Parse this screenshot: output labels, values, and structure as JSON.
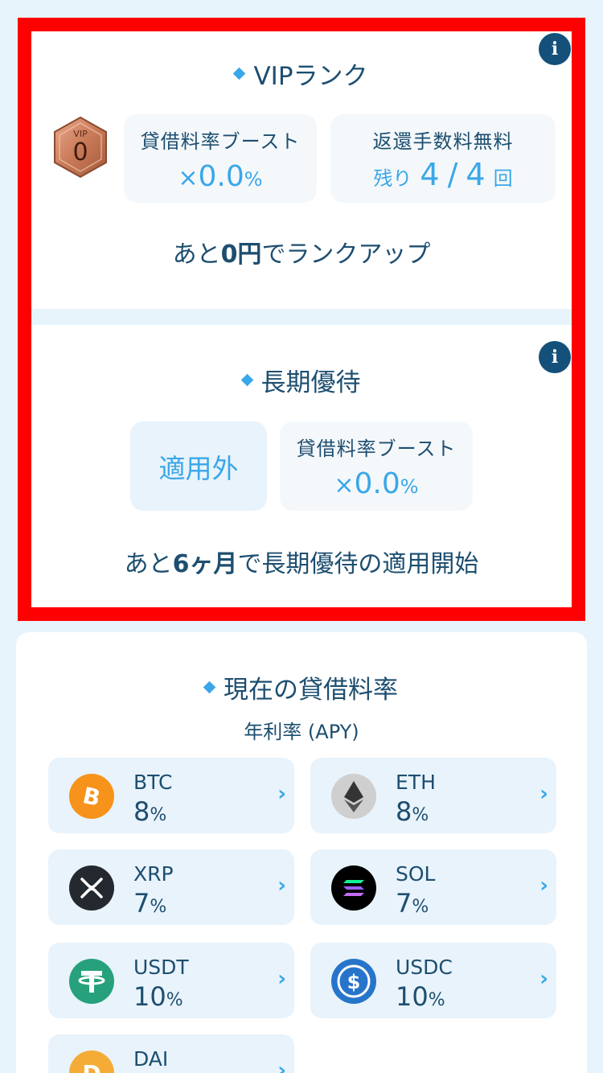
{
  "vip": {
    "title": "VIPランク",
    "badge_label": "VIP",
    "badge_level": "0",
    "boost_label": "貸借料率ブースト",
    "boost_x": "×",
    "boost_value": "0.0",
    "boost_pct": "%",
    "refund_label": "返還手数料無料",
    "remain_prefix": "残り",
    "remain_current": "4",
    "remain_sep": "/",
    "remain_total": "4",
    "remain_unit": "回",
    "msg_pre": "あと",
    "msg_bold": "0円",
    "msg_post": "でランクアップ"
  },
  "longterm": {
    "title": "長期優待",
    "status": "適用外",
    "boost_label": "貸借料率ブースト",
    "boost_x": "×",
    "boost_value": "0.0",
    "boost_pct": "%",
    "msg_pre": "あと",
    "msg_bold": "6ヶ月",
    "msg_post": "で長期優待の適用開始"
  },
  "rates": {
    "title": "現在の貸借料率",
    "subtitle": "年利率 (APY)",
    "pct": "%",
    "coins": [
      {
        "name": "BTC",
        "rate": "8",
        "icon": "btc-icon",
        "color": "#f7931a"
      },
      {
        "name": "ETH",
        "rate": "8",
        "icon": "eth-icon",
        "color": "#c9c9c9"
      },
      {
        "name": "XRP",
        "rate": "7",
        "icon": "xrp-icon",
        "color": "#23292f"
      },
      {
        "name": "SOL",
        "rate": "7",
        "icon": "sol-icon",
        "color": "#000000"
      },
      {
        "name": "USDT",
        "rate": "10",
        "icon": "usdt-icon",
        "color": "#26a17b"
      },
      {
        "name": "USDC",
        "rate": "10",
        "icon": "usdc-icon",
        "color": "#2775ca"
      },
      {
        "name": "DAI",
        "rate": "",
        "icon": "dai-icon",
        "color": "#f5ac37"
      }
    ]
  },
  "colors": {
    "accent": "#3aa7e8",
    "text": "#1d4e70",
    "highlight_frame": "#ff0000",
    "background": "#e8f4fc"
  }
}
